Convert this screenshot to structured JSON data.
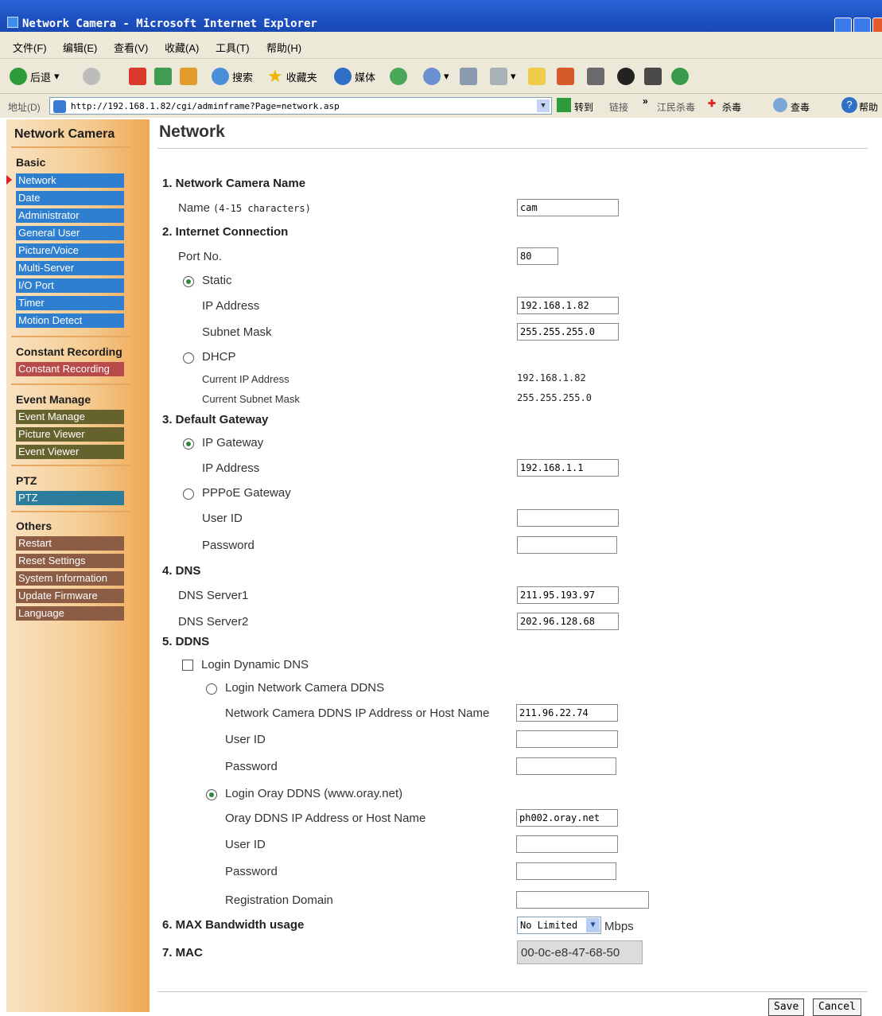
{
  "window": {
    "title": "Network Camera - Microsoft Internet Explorer"
  },
  "menu": [
    "文件(F)",
    "编辑(E)",
    "查看(V)",
    "收藏(A)",
    "工具(T)",
    "帮助(H)"
  ],
  "toolbar": {
    "back": "后退",
    "search": "搜索",
    "favorites": "收藏夹",
    "media": "媒体"
  },
  "address": {
    "label": "地址(D)",
    "url": "http://192.168.1.82/cgi/adminframe?Page=network.asp",
    "go": "转到",
    "links": "链接",
    "chevron": "»",
    "ext1": "江民杀毒",
    "ext2": "杀毒",
    "ext3": "查毒",
    "help": "帮助"
  },
  "sidebar": {
    "title": "Network Camera",
    "basic": {
      "heading": "Basic",
      "items": [
        "Network",
        "Date",
        "Administrator",
        "General User",
        "Picture/Voice",
        "Multi-Server",
        "I/O Port",
        "Timer",
        "Motion Detect"
      ]
    },
    "constant": {
      "heading": "Constant Recording",
      "items": [
        "Constant Recording"
      ]
    },
    "event": {
      "heading": "Event Manage",
      "items": [
        "Event Manage",
        "Picture Viewer",
        "Event Viewer"
      ]
    },
    "ptz": {
      "heading": "PTZ",
      "items": [
        "PTZ"
      ]
    },
    "others": {
      "heading": "Others",
      "items": [
        "Restart",
        "Reset Settings",
        "System Information",
        "Update Firmware",
        "Language"
      ]
    }
  },
  "page": {
    "title": "Network",
    "s1": {
      "heading": "1. Network Camera Name",
      "name_label": "Name",
      "name_hint": "(4-15 characters)",
      "name_value": "cam"
    },
    "s2": {
      "heading": "2. Internet Connection",
      "port_label": "Port No.",
      "port_value": "80",
      "static_label": "Static",
      "ip_label": "IP Address",
      "ip_value": "192.168.1.82",
      "mask_label": "Subnet Mask",
      "mask_value": "255.255.255.0",
      "dhcp_label": "DHCP",
      "cur_ip_label": "Current IP Address",
      "cur_ip_value": "192.168.1.82",
      "cur_mask_label": "Current Subnet Mask",
      "cur_mask_value": "255.255.255.0"
    },
    "s3": {
      "heading": "3. Default Gateway",
      "ipgw_label": "IP Gateway",
      "ip_label": "IP Address",
      "ip_value": "192.168.1.1",
      "pppoe_label": "PPPoE Gateway",
      "user_label": "User ID",
      "user_value": "",
      "pass_label": "Password",
      "pass_value": ""
    },
    "s4": {
      "heading": "4. DNS",
      "dns1_label": "DNS Server1",
      "dns1_value": "211.95.193.97",
      "dns2_label": "DNS Server2",
      "dns2_value": "202.96.128.68"
    },
    "s5": {
      "heading": "5. DDNS",
      "login_label": "Login Dynamic DNS",
      "camddns_label": "Login Network Camera DDNS",
      "camhost_label": "Network Camera DDNS IP Address or Host Name",
      "camhost_value": "211.96.22.74",
      "user_label": "User ID",
      "pass_label": "Password",
      "oray_label": "Login Oray DDNS (www.oray.net)",
      "orayhost_label": "Oray DDNS IP Address or Host Name",
      "orayhost_value": "ph002.oray.net",
      "oray_user_label": "User ID",
      "oray_pass_label": "Password",
      "regdomain_label": "Registration Domain"
    },
    "s6": {
      "heading": "6. MAX Bandwidth usage",
      "value": "No Limited",
      "unit": "Mbps"
    },
    "s7": {
      "heading": "7. MAC",
      "value": "00-0c-e8-47-68-50"
    },
    "buttons": {
      "save": "Save",
      "cancel": "Cancel"
    }
  }
}
